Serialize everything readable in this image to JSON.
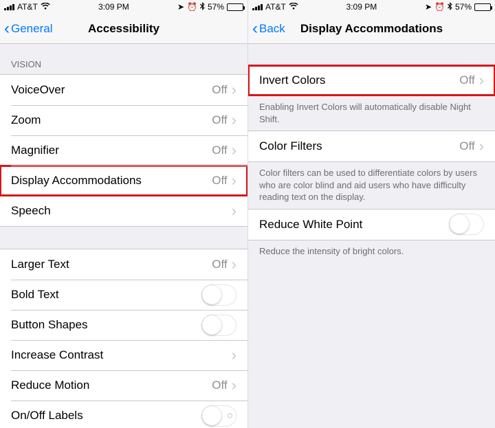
{
  "status": {
    "carrier": "AT&T",
    "time": "3:09 PM",
    "battery_pct": "57%"
  },
  "left": {
    "back_label": "General",
    "title": "Accessibility",
    "section_vision": "VISION",
    "rows_vision": [
      {
        "label": "VoiceOver",
        "value": "Off"
      },
      {
        "label": "Zoom",
        "value": "Off"
      },
      {
        "label": "Magnifier",
        "value": "Off"
      },
      {
        "label": "Display Accommodations",
        "value": "Off"
      },
      {
        "label": "Speech",
        "value": ""
      }
    ],
    "rows_text": [
      {
        "label": "Larger Text",
        "value": "Off"
      },
      {
        "label": "Bold Text"
      },
      {
        "label": "Button Shapes"
      },
      {
        "label": "Increase Contrast",
        "value": ""
      },
      {
        "label": "Reduce Motion",
        "value": "Off"
      },
      {
        "label": "On/Off Labels"
      }
    ]
  },
  "right": {
    "back_label": "Back",
    "title": "Display Accommodations",
    "rows": [
      {
        "label": "Invert Colors",
        "value": "Off"
      },
      {
        "label": "Color Filters",
        "value": "Off"
      },
      {
        "label": "Reduce White Point"
      }
    ],
    "footers": {
      "invert": "Enabling Invert Colors will automatically disable Night Shift.",
      "filters": "Color filters can be used to differentiate colors by users who are color blind and aid users who have difficulty reading text on the display.",
      "whitepoint": "Reduce the intensity of bright colors."
    }
  }
}
